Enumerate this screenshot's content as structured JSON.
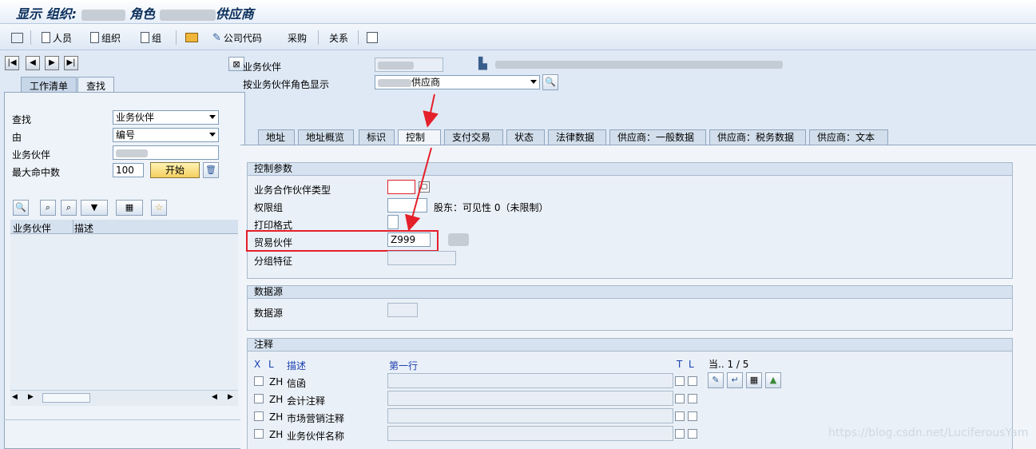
{
  "window": {
    "title_prefix": "显示 组织:",
    "title_mid": "角色",
    "title_suffix": "供应商"
  },
  "toolbar": {
    "persons": "人员",
    "org": "组织",
    "group": "组",
    "company_code": "公司代码",
    "purchasing": "采购",
    "relations": "关系"
  },
  "left": {
    "tabs": [
      "工作清单",
      "查找"
    ],
    "find_label": "查找",
    "find_value": "业务伙伴",
    "by_label": "由",
    "by_value": "编号",
    "bp_label": "业务伙伴",
    "max_hits_label": "最大命中数",
    "max_hits_value": "100",
    "start_button": "开始",
    "columns": [
      "业务伙伴",
      "描述"
    ]
  },
  "header": {
    "bp_label": "业务伙伴",
    "role_label": "按业务伙伴角色显示",
    "role_value": "供应商"
  },
  "tabs": [
    "地址",
    "地址概览",
    "标识",
    "控制",
    "支付交易",
    "状态",
    "法律数据",
    "供应商：一般数据",
    "供应商：税务数据",
    "供应商：文本"
  ],
  "control_params": {
    "title": "控制参数",
    "bp_type": "业务合作伙伴类型",
    "auth_group": "权限组",
    "auth_note": "股东：可见性 0（未限制）",
    "print_format": "打印格式",
    "trading_partner": "贸易伙伴",
    "trading_partner_value": "Z999",
    "grouping": "分组特征"
  },
  "data_source": {
    "title": "数据源",
    "label": "数据源"
  },
  "notes": {
    "title": "注释",
    "col_x": "X",
    "col_l": "L",
    "col_desc": "描述",
    "col_first": "第一行",
    "col_t": "T",
    "col_l2": "L",
    "paging": "当..  1 /  5",
    "rows": [
      {
        "lang": "ZH",
        "desc": "信函"
      },
      {
        "lang": "ZH",
        "desc": "会计注释"
      },
      {
        "lang": "ZH",
        "desc": "市场营销注释"
      },
      {
        "lang": "ZH",
        "desc": "业务伙伴名称"
      }
    ]
  },
  "watermark": "https://blog.csdn.net/LuciferousYam",
  "colors": {
    "highlight_red": "#e4202a",
    "button_yellow": "#f4cf5e"
  }
}
